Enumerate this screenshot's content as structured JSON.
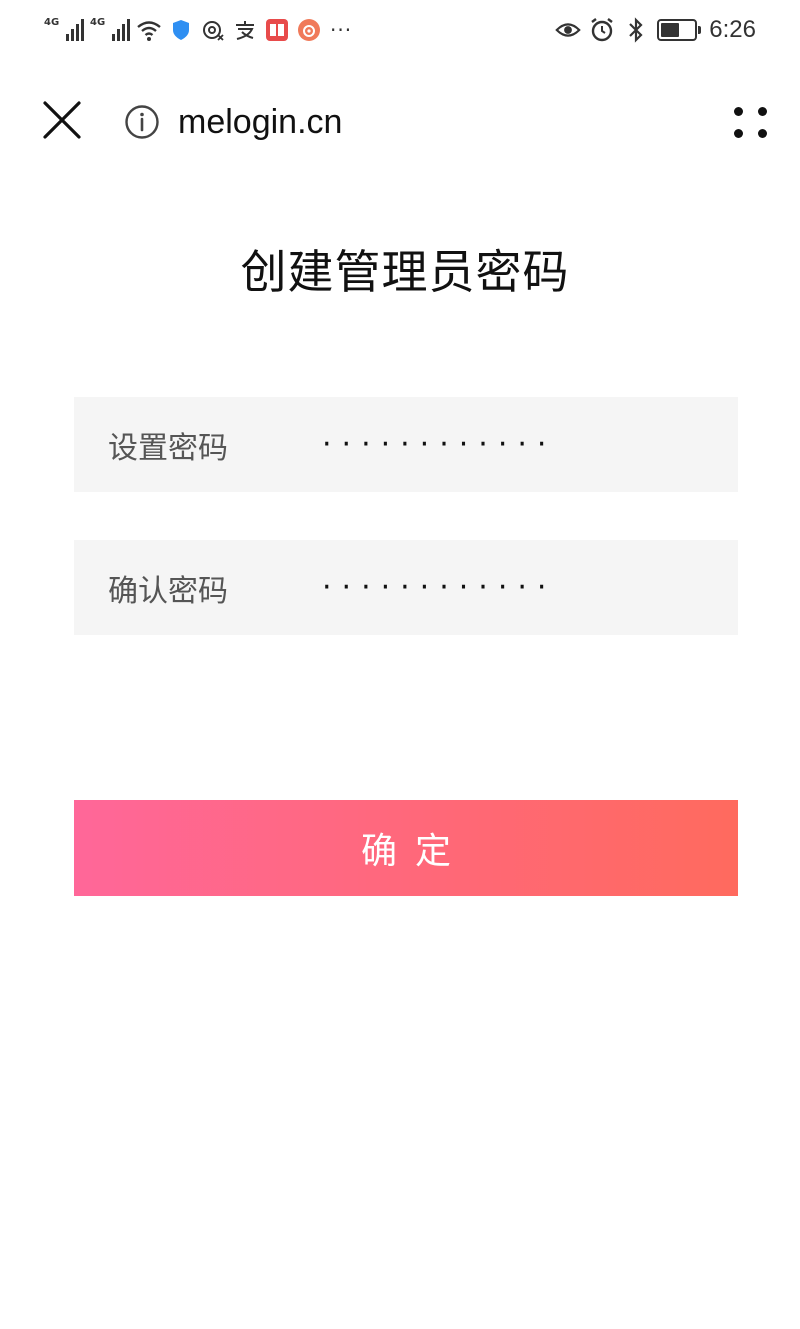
{
  "status_bar": {
    "signal1_label": "4G",
    "signal2_label": "4G",
    "overflow_dots": "···",
    "time": "6:26",
    "battery_level": 0.55,
    "icons": [
      "signal-icon",
      "signal-icon",
      "wifi-icon",
      "shield-icon",
      "nfc-icon",
      "alipay-icon",
      "book-app-icon",
      "weibo-icon",
      "eye-icon",
      "alarm-icon",
      "bluetooth-icon",
      "battery-icon"
    ]
  },
  "browser": {
    "url": "melogin.cn"
  },
  "page": {
    "title": "创建管理员密码",
    "fields": [
      {
        "label": "设置密码",
        "value": "············"
      },
      {
        "label": "确认密码",
        "value": "············"
      }
    ],
    "confirm_label": "确定"
  },
  "colors": {
    "button_gradient_start": "#ff6799",
    "button_gradient_end": "#ff6a5e",
    "field_background": "#f5f5f5"
  }
}
